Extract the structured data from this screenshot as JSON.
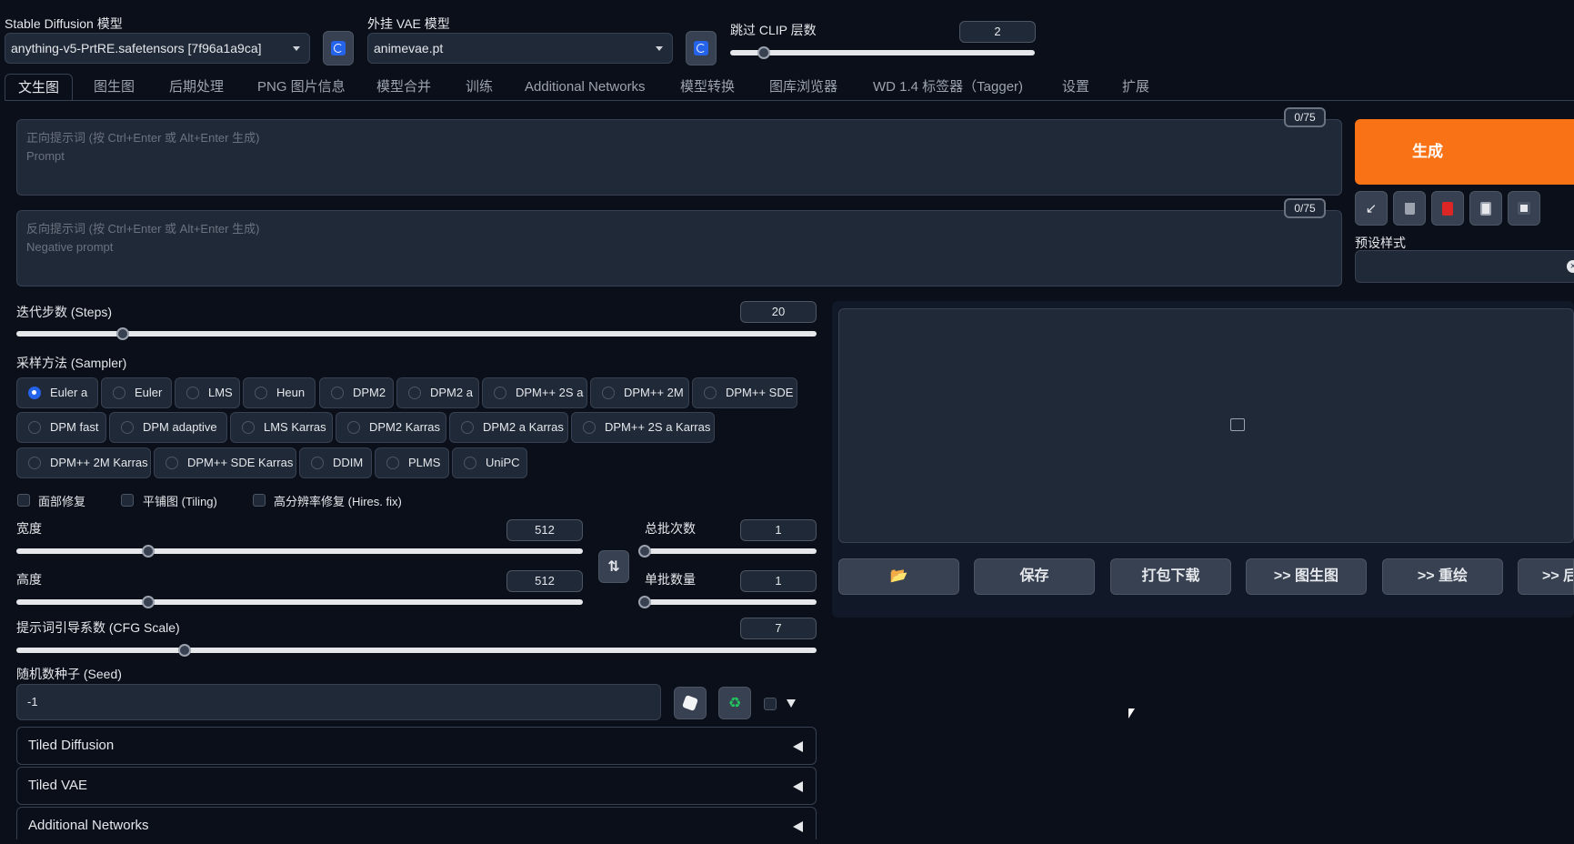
{
  "models": {
    "sd_label": "Stable Diffusion 模型",
    "sd_value": "anything-v5-PrtRE.safetensors [7f96a1a9ca]",
    "vae_label": "外挂 VAE 模型",
    "vae_value": "animevae.pt",
    "clip_label": "跳过 CLIP 层数",
    "clip_value": "2",
    "clip_fraction": 0.11
  },
  "tabs": [
    "文生图",
    "图生图",
    "后期处理",
    "PNG 图片信息",
    "模型合并",
    "训练",
    "Additional Networks",
    "模型转换",
    "图库浏览器",
    "WD 1.4 标签器（Tagger)",
    "设置",
    "扩展"
  ],
  "prompt": {
    "placeholder_line1": "正向提示词 (按 Ctrl+Enter 或 Alt+Enter 生成)",
    "placeholder_line2": "Prompt",
    "counter": "0/75"
  },
  "negative": {
    "placeholder_line1": "反向提示词 (按 Ctrl+Enter 或 Alt+Enter 生成)",
    "placeholder_line2": "Negative prompt",
    "counter": "0/75"
  },
  "generate_label": "生成",
  "toolbar_icons": [
    "arrow-icon",
    "trash-icon",
    "red-card-icon",
    "clipboard-icon",
    "save-icon"
  ],
  "styles_label": "预设样式",
  "steps": {
    "label": "迭代步数 (Steps)",
    "value": "20",
    "fraction": 0.133
  },
  "sampler": {
    "label": "采样方法 (Sampler)",
    "selected": "Euler a",
    "rows": [
      [
        "Euler a",
        "Euler",
        "LMS",
        "Heun",
        "DPM2",
        "DPM2 a",
        "DPM++ 2S a",
        "DPM++ 2M",
        "DPM++ SDE"
      ],
      [
        "DPM fast",
        "DPM adaptive",
        "LMS Karras",
        "DPM2 Karras",
        "DPM2 a Karras",
        "DPM++ 2S a Karras"
      ],
      [
        "DPM++ 2M Karras",
        "DPM++ SDE Karras",
        "DDIM",
        "PLMS",
        "UniPC"
      ]
    ]
  },
  "checkboxes": [
    "面部修复",
    "平铺图 (Tiling)",
    "高分辨率修复 (Hires. fix)"
  ],
  "width": {
    "label": "宽度",
    "value": "512",
    "fraction": 0.233
  },
  "height": {
    "label": "高度",
    "value": "512",
    "fraction": 0.233
  },
  "batch_count": {
    "label": "总批次数",
    "value": "1",
    "fraction": 0.0
  },
  "batch_size": {
    "label": "单批数量",
    "value": "1",
    "fraction": 0.0
  },
  "swap_icon": "swap-icon",
  "cfg": {
    "label": "提示词引导系数 (CFG Scale)",
    "value": "7",
    "fraction": 0.21
  },
  "seed": {
    "label": "随机数种子 (Seed)",
    "value": "-1"
  },
  "output_buttons": [
    "📂",
    "保存",
    "打包下载",
    ">> 图生图",
    ">> 重绘",
    ">> 后期"
  ],
  "accordions": [
    "Tiled Diffusion",
    "Tiled VAE",
    "Additional Networks"
  ]
}
